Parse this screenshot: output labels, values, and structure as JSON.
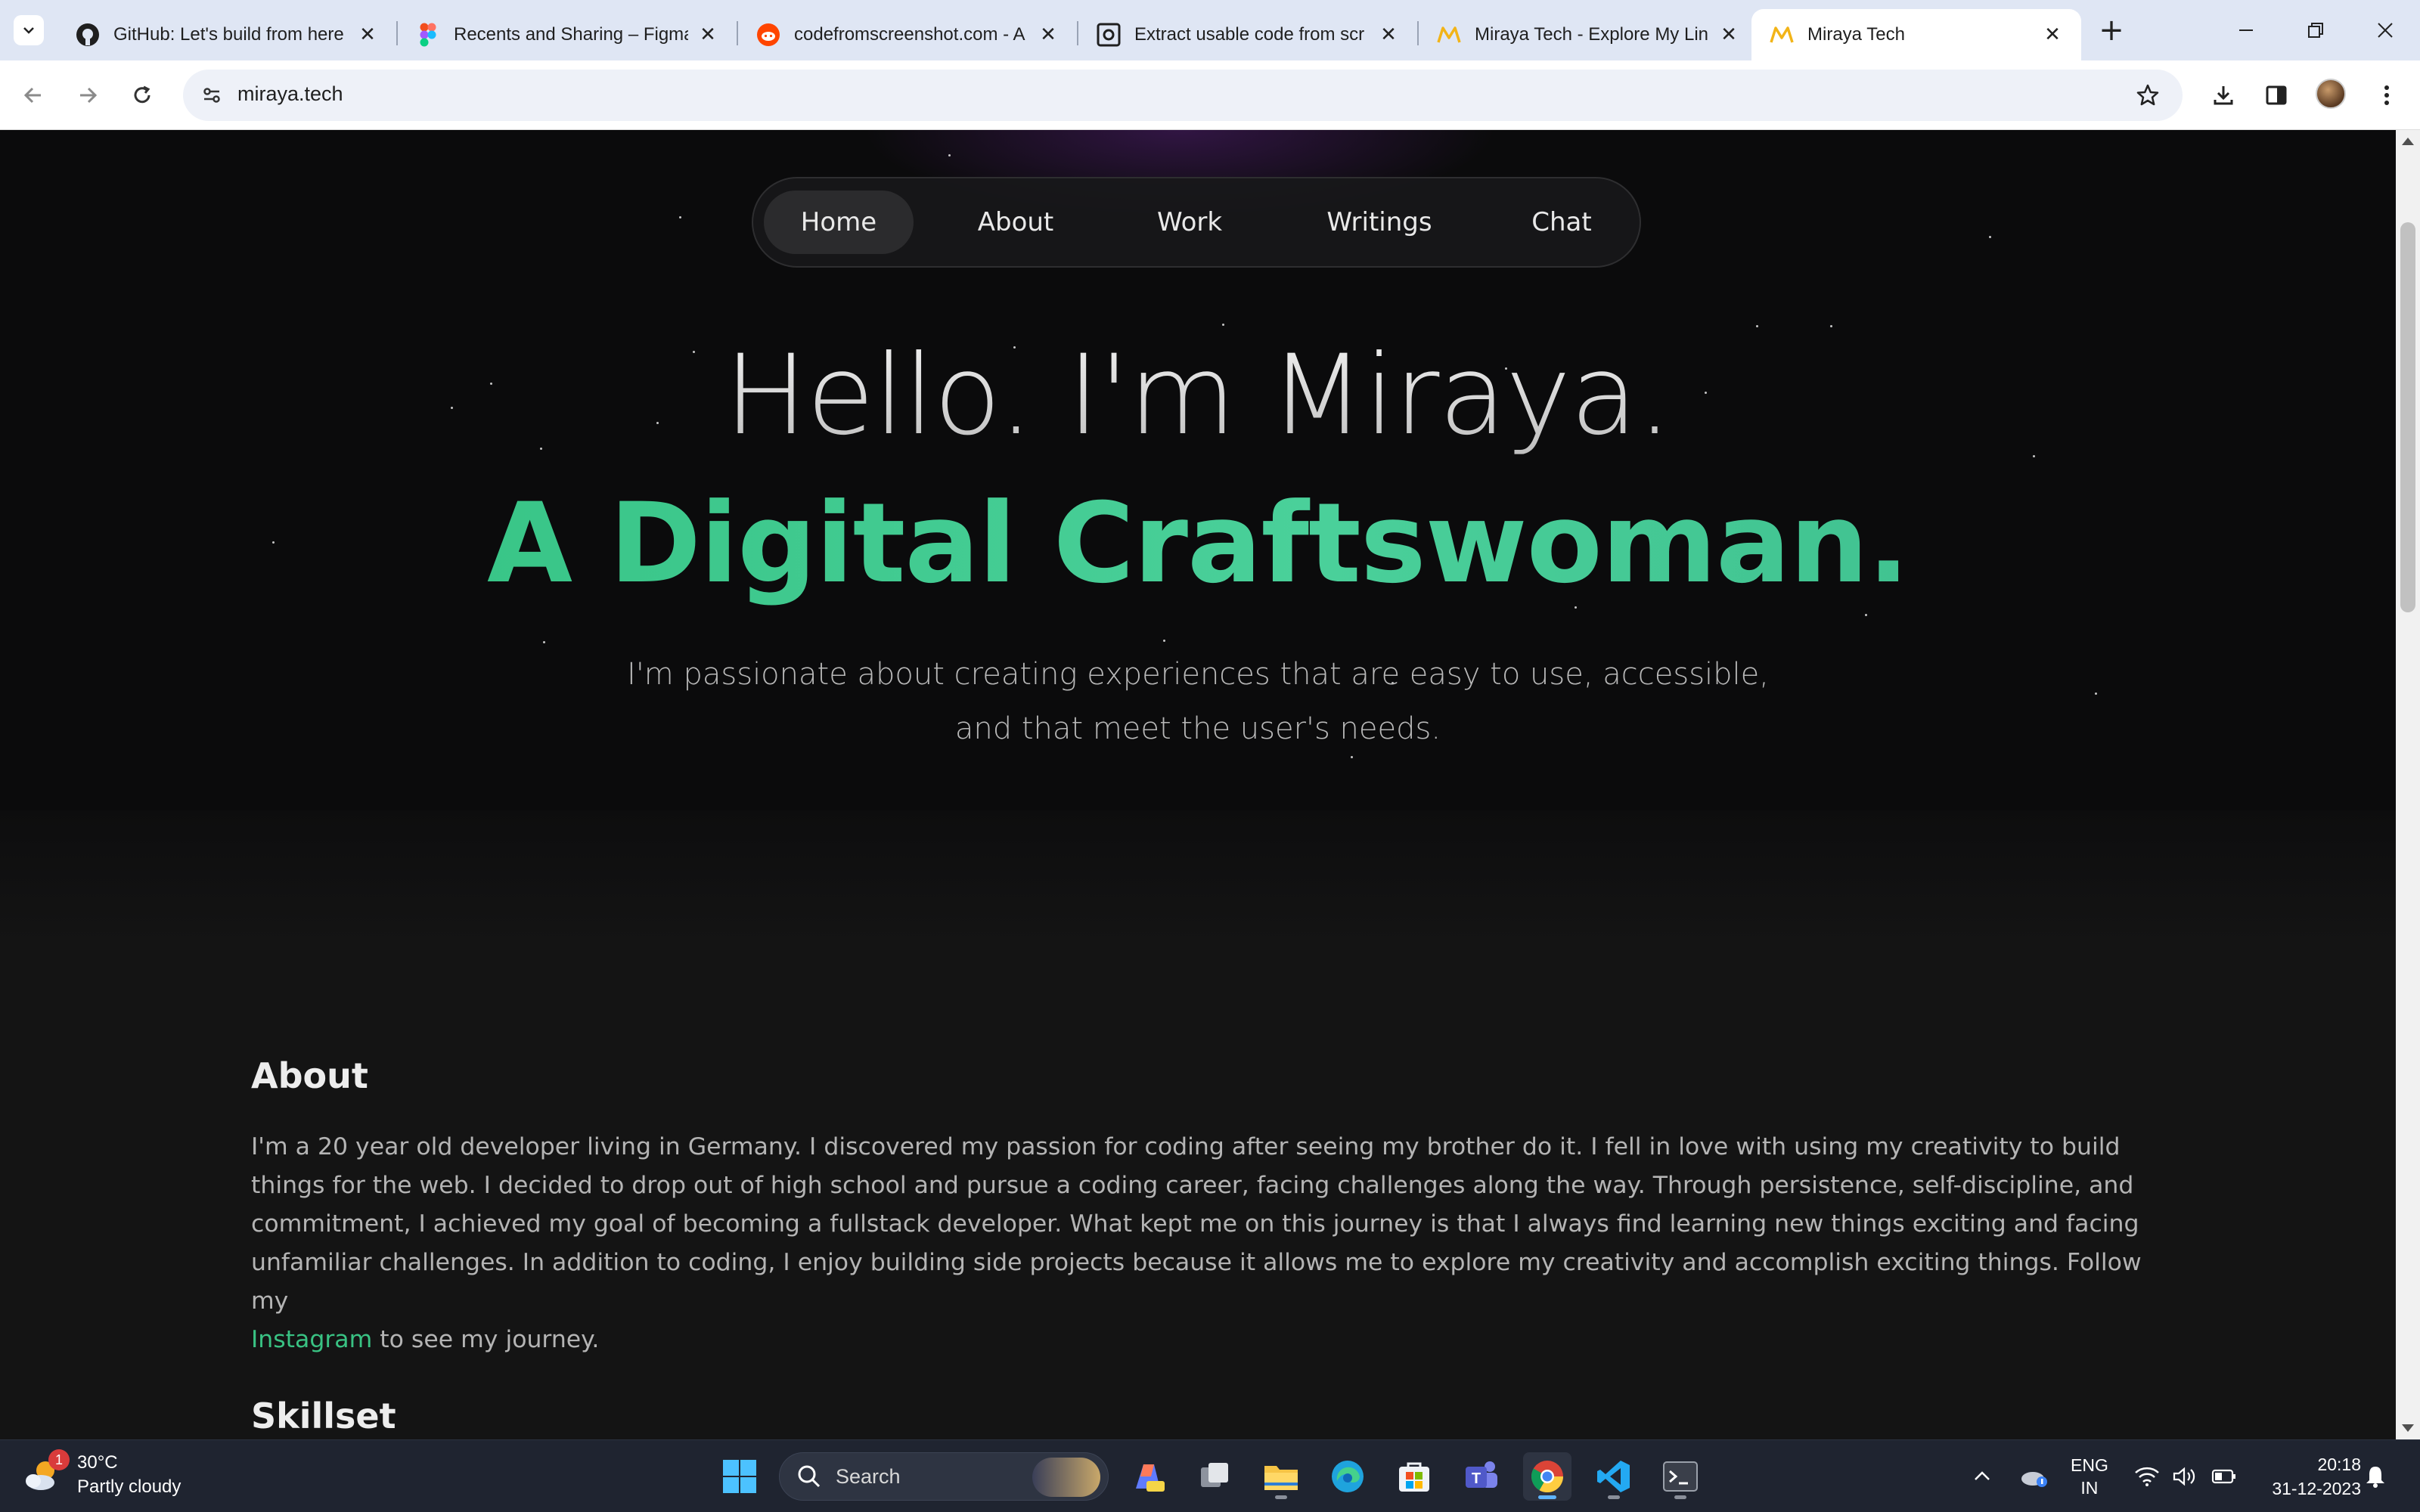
{
  "browser": {
    "tabs": [
      {
        "title": "GitHub: Let's build from here",
        "icon": "github-icon"
      },
      {
        "title": "Recents and Sharing – Figma",
        "icon": "figma-icon"
      },
      {
        "title": "codefromscreenshot.com - A",
        "icon": "reddit-icon"
      },
      {
        "title": "Extract usable code from scr",
        "icon": "screenshot-tool-icon"
      },
      {
        "title": "Miraya Tech - Explore My Lin",
        "icon": "miraya-icon"
      },
      {
        "title": "Miraya Tech",
        "icon": "miraya-icon",
        "active": true
      }
    ],
    "url": "miraya.tech"
  },
  "site": {
    "nav": [
      "Home",
      "About",
      "Work",
      "Writings",
      "Chat"
    ],
    "active_nav": "Home",
    "hero": {
      "greeting": "Hello. I'm Miraya.",
      "tagline": "A Digital Craftswoman.",
      "subtitle": "I'm passionate about creating experiences that are easy to use, accessible, and that meet the user's needs."
    },
    "about": {
      "title": "About",
      "text_before_link": "I'm a 20 year old developer living in Germany. I discovered my passion for coding after seeing my brother do it. I fell in love with using my creativity to build things for the web. I decided to drop out of high school and pursue a coding career, facing challenges along the way. Through persistence, self-discipline, and commitment, I achieved my goal of becoming a fullstack developer. What kept me on this journey is that I always find learning new things exciting and facing unfamiliar challenges. In addition to coding, I enjoy building side projects because it allows me to explore my creativity and accomplish exciting things. Follow my",
      "link_text": "Instagram",
      "text_after_link": "to see my journey."
    },
    "skillset": {
      "title": "Skillset"
    },
    "colors": {
      "accent": "#39c283",
      "background": "#0b0b0c"
    }
  },
  "taskbar": {
    "weather": {
      "temp": "30°C",
      "condition": "Partly cloudy",
      "badge": "1"
    },
    "search_placeholder": "Search",
    "language": "ENG",
    "region": "IN",
    "time": "20:18",
    "date": "31-12-2023"
  }
}
